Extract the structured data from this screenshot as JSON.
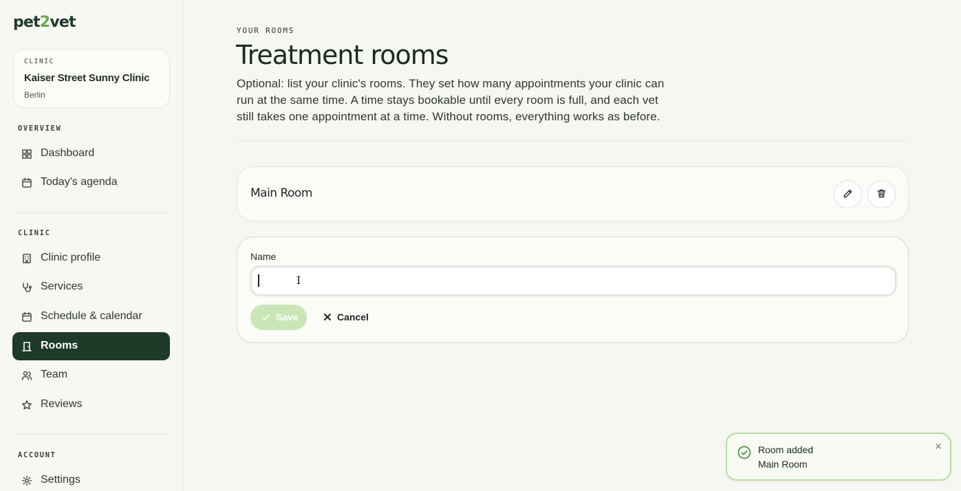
{
  "brand": {
    "logo_pre": "pet",
    "logo_num": "2",
    "logo_post": "vet"
  },
  "clinic_card": {
    "label": "CLINIC",
    "name": "Kaiser Street Sunny Clinic",
    "city": "Berlin"
  },
  "sidebar": {
    "overview_label": "OVERVIEW",
    "clinic_label": "CLINIC",
    "account_label": "ACCOUNT",
    "items": [
      {
        "label": "Dashboard",
        "icon": "grid-icon"
      },
      {
        "label": "Today's agenda",
        "icon": "calendar-icon"
      },
      {
        "label": "Clinic profile",
        "icon": "building-icon"
      },
      {
        "label": "Services",
        "icon": "stethoscope-icon"
      },
      {
        "label": "Schedule & calendar",
        "icon": "calendar-icon"
      },
      {
        "label": "Rooms",
        "icon": "door-icon",
        "active": true
      },
      {
        "label": "Team",
        "icon": "users-icon"
      },
      {
        "label": "Reviews",
        "icon": "star-icon"
      },
      {
        "label": "Settings",
        "icon": "gear-icon"
      }
    ]
  },
  "page": {
    "eyebrow": "YOUR ROOMS",
    "title": "Treatment rooms",
    "intro": "Optional: list your clinic's rooms. They set how many appointments your clinic can run at the same time. A time stays bookable until every room is full, and each vet still takes one appointment at a time. Without rooms, everything works as before."
  },
  "rooms": [
    {
      "name": "Main Room"
    }
  ],
  "form": {
    "name_label": "Name",
    "name_value": "",
    "save_label": "Save",
    "cancel_label": "Cancel"
  },
  "toast": {
    "title": "Room added",
    "message": "Main Room"
  },
  "colors": {
    "accent_dark": "#1e3b2a",
    "accent_light": "#c8e6b6",
    "success": "#3f8a34"
  }
}
